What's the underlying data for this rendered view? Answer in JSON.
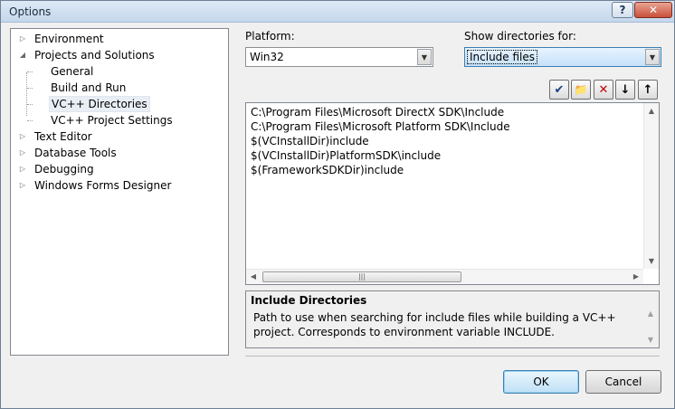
{
  "window": {
    "title": "Options",
    "help_label": "?",
    "close_label": "✕"
  },
  "tree": {
    "items": [
      {
        "label": "Environment",
        "expander": "▷"
      },
      {
        "label": "Projects and Solutions",
        "expander": "◢"
      },
      {
        "label": "General"
      },
      {
        "label": "Build and Run"
      },
      {
        "label": "VC++ Directories"
      },
      {
        "label": "VC++ Project Settings"
      },
      {
        "label": "Text Editor",
        "expander": "▷"
      },
      {
        "label": "Database Tools",
        "expander": "▷"
      },
      {
        "label": "Debugging",
        "expander": "▷"
      },
      {
        "label": "Windows Forms Designer",
        "expander": "▷"
      }
    ]
  },
  "platform": {
    "label": "Platform:",
    "value": "Win32"
  },
  "show_dirs": {
    "label": "Show directories for:",
    "value": "Include files"
  },
  "toolbar": {
    "check_icon": "✔",
    "newfolder_icon": "📁",
    "delete_icon": "✕",
    "down_icon": "↓",
    "up_icon": "↑"
  },
  "directories": [
    "C:\\Program Files\\Microsoft DirectX SDK\\Include",
    "C:\\Program Files\\Microsoft Platform SDK\\Include",
    "$(VCInstallDir)include",
    "$(VCInstallDir)PlatformSDK\\include",
    "$(FrameworkSDKDir)include"
  ],
  "description": {
    "title": "Include Directories",
    "text": "Path to use when searching for include files while building a VC++ project. Corresponds to environment variable INCLUDE."
  },
  "buttons": {
    "ok": "OK",
    "cancel": "Cancel"
  },
  "colors": {
    "accent": "#3c7fb1",
    "selection": "#c5e1fa"
  }
}
